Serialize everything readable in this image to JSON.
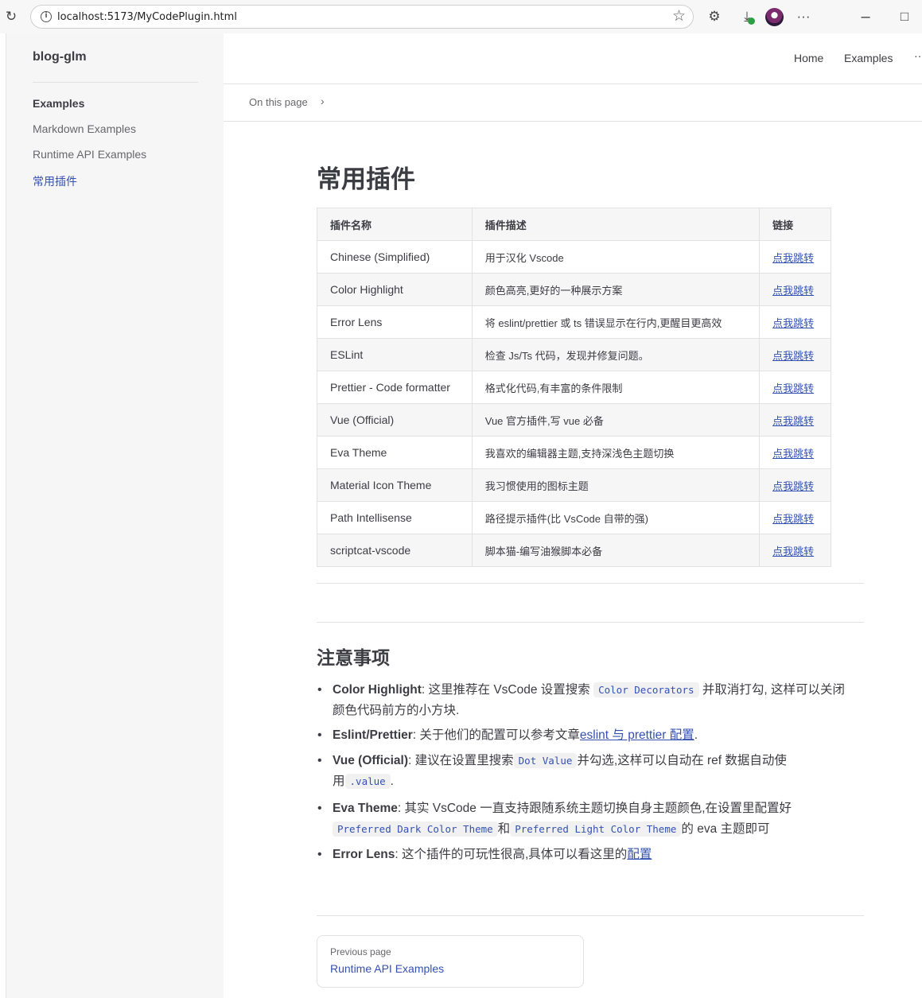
{
  "browser": {
    "url": "localhost:5173/MyCodePlugin.html",
    "menu_label": "···"
  },
  "sidebar": {
    "site_title": "blog-glm",
    "group_title": "Examples",
    "items": [
      {
        "label": "Markdown Examples"
      },
      {
        "label": "Runtime API Examples"
      },
      {
        "label": "常用插件"
      }
    ]
  },
  "nav": {
    "links": [
      {
        "label": "Home"
      },
      {
        "label": "Examples"
      }
    ],
    "more": "··"
  },
  "outline": {
    "label": "On this page",
    "chevron": "›"
  },
  "page": {
    "title": "常用插件",
    "table": {
      "headers": [
        "插件名称",
        "插件描述",
        "链接"
      ],
      "rows": [
        {
          "name": "Chinese (Simplified)",
          "desc": "用于汉化 Vscode",
          "link": "点我跳转"
        },
        {
          "name": "Color Highlight",
          "desc": "颜色高亮,更好的一种展示方案",
          "link": "点我跳转"
        },
        {
          "name": "Error Lens",
          "desc": "将 eslint/prettier 或 ts 错误显示在行内,更醒目更高效",
          "link": "点我跳转"
        },
        {
          "name": "ESLint",
          "desc": "检查 Js/Ts 代码，发现并修复问题。",
          "link": "点我跳转"
        },
        {
          "name": "Prettier - Code formatter",
          "desc": "格式化代码,有丰富的条件限制",
          "link": "点我跳转"
        },
        {
          "name": "Vue (Official)",
          "desc": "Vue 官方插件,写 vue 必备",
          "link": "点我跳转"
        },
        {
          "name": "Eva Theme",
          "desc": "我喜欢的编辑器主题,支持深浅色主题切换",
          "link": "点我跳转"
        },
        {
          "name": "Material Icon Theme",
          "desc": "我习惯使用的图标主题",
          "link": "点我跳转"
        },
        {
          "name": "Path Intellisense",
          "desc": "路径提示插件(比 VsCode 自带的强)",
          "link": "点我跳转"
        },
        {
          "name": "scriptcat-vscode",
          "desc": "脚本猫-编写油猴脚本必备",
          "link": "点我跳转"
        }
      ]
    },
    "notes_title": "注意事项",
    "notes": {
      "n1": {
        "bold": "Color Highlight",
        "t1": ": 这里推荐在 VsCode 设置搜索 ",
        "code": "Color Decorators",
        "t2": " 并取消打勾, 这样可以关闭",
        "t3": "颜色代码前方的小方块."
      },
      "n2": {
        "bold": "Eslint/Prettier",
        "t1": ": 关于他们的配置可以参考文章",
        "link": "eslint 与 prettier 配置",
        "t2": "."
      },
      "n3": {
        "bold": "Vue (Official)",
        "t1": ": 建议在设置里搜索",
        "code": "Dot Value",
        "t2": "并勾选,这样可以自动在 ref 数据自动使",
        "t3": "用",
        "code2": ".value",
        "t4": "."
      },
      "n4": {
        "bold": "Eva Theme",
        "t1": ": 其实 VsCode 一直支持跟随系统主题切换自身主题颜色,在设置里配置好",
        "code": "Preferred Dark Color Theme",
        "t2": "和",
        "code2": "Preferred Light Color Theme",
        "t3": "的 eva 主题即可"
      },
      "n5": {
        "bold": "Error Lens",
        "t1": ": 这个插件的可玩性很高,具体可以看这里的",
        "link": "配置"
      }
    },
    "prev": {
      "label": "Previous page",
      "title": "Runtime API Examples"
    }
  },
  "colors": {
    "brand": "#3451b2",
    "text": "#3c3c43",
    "muted": "#67676c",
    "sidebar_bg": "#f6f6f7",
    "border": "#e2e2e3"
  }
}
